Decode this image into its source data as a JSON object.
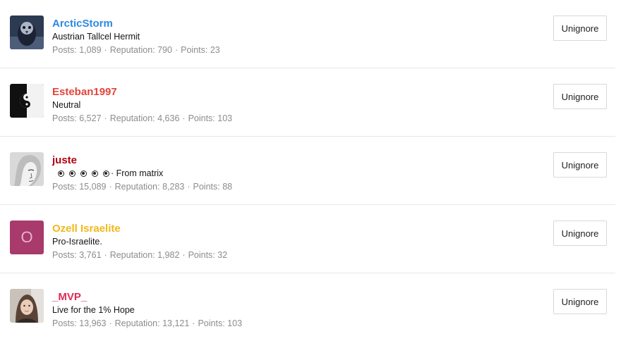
{
  "users": [
    {
      "username": "ArcticStorm",
      "name_color": "#2b8ae2",
      "title": "Austrian Tallcel Hermit",
      "posts": "1,089",
      "reputation": "790",
      "points": "23",
      "avatar": "bird-photo-avatar"
    },
    {
      "username": "Esteban1997",
      "name_color": "#e2453c",
      "title": "Neutral",
      "posts": "6,527",
      "reputation": "4,636",
      "points": "103",
      "avatar": "yin-yang-avatar"
    },
    {
      "username": "juste",
      "name_color": "#b00012",
      "title": "· From matrix",
      "stars": 5,
      "posts": "15,089",
      "reputation": "8,283",
      "points": "88",
      "avatar": "face-sketch-avatar"
    },
    {
      "username": "Ozell Israelite",
      "name_color": "#f0b91a",
      "title": "Pro-Israelite.",
      "posts": "3,761",
      "reputation": "1,982",
      "points": "32",
      "avatar_letter": "O",
      "avatar_color": "#a83a6c"
    },
    {
      "username": "_MVP_",
      "name_color": "#e02b55",
      "title": "Live for the 1% Hope",
      "posts": "13,963",
      "reputation": "13,121",
      "points": "103",
      "avatar": "person-photo-avatar"
    }
  ],
  "labels": {
    "posts": "Posts:",
    "reputation": "Reputation:",
    "points": "Points:",
    "separator": "·",
    "unignore": "Unignore"
  }
}
